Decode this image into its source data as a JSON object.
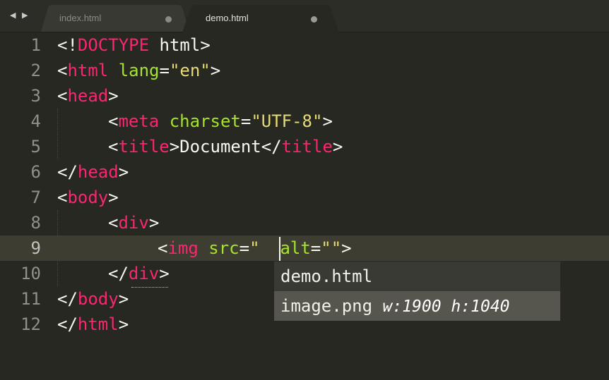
{
  "tabs": [
    {
      "label": "index.html",
      "active": false
    },
    {
      "label": "demo.html",
      "active": true
    }
  ],
  "nav": {
    "back": "◀",
    "forward": "▶"
  },
  "line_numbers": [
    "1",
    "2",
    "3",
    "4",
    "5",
    "6",
    "7",
    "8",
    "9",
    "10",
    "11",
    "12"
  ],
  "active_line": "9",
  "code": {
    "l1": {
      "open": "<!",
      "kw": "DOCTYPE",
      "rest": " html",
      "close": ">"
    },
    "l2": {
      "open": "<",
      "tag": "html",
      "sp": " ",
      "attr": "lang",
      "eq": "=",
      "val": "\"en\"",
      "close": ">"
    },
    "l3": {
      "open": "<",
      "tag": "head",
      "close": ">"
    },
    "l4": {
      "open": "<",
      "tag": "meta",
      "sp": " ",
      "attr": "charset",
      "eq": "=",
      "val": "\"UTF-8\"",
      "close": ">"
    },
    "l5": {
      "open": "<",
      "tag": "title",
      "close": ">",
      "text": "Document",
      "open2": "</",
      "tag2": "title",
      "close2": ">"
    },
    "l6": {
      "open": "</",
      "tag": "head",
      "close": ">"
    },
    "l7": {
      "open": "<",
      "tag": "body",
      "close": ">"
    },
    "l8": {
      "open": "<",
      "tag": "div",
      "close": ">"
    },
    "l9": {
      "open": "<",
      "tag": "img",
      "sp": " ",
      "attr": "src",
      "eq": "=",
      "q1": "\"",
      "q2": "\"",
      "sp2": " ",
      "attr2": "alt",
      "eq2": "=",
      "val2": "\"\"",
      "close": ">"
    },
    "l10": {
      "open": "</",
      "tag": "div",
      "close": ">"
    },
    "l11": {
      "open": "</",
      "tag": "body",
      "close": ">"
    },
    "l12": {
      "open": "</",
      "tag": "html",
      "close": ">"
    }
  },
  "autocomplete": {
    "items": [
      {
        "label": "demo.html",
        "annotation": ""
      },
      {
        "label": "image.png",
        "annotation": "w:1900 h:1040"
      }
    ],
    "selected_index": 1
  }
}
